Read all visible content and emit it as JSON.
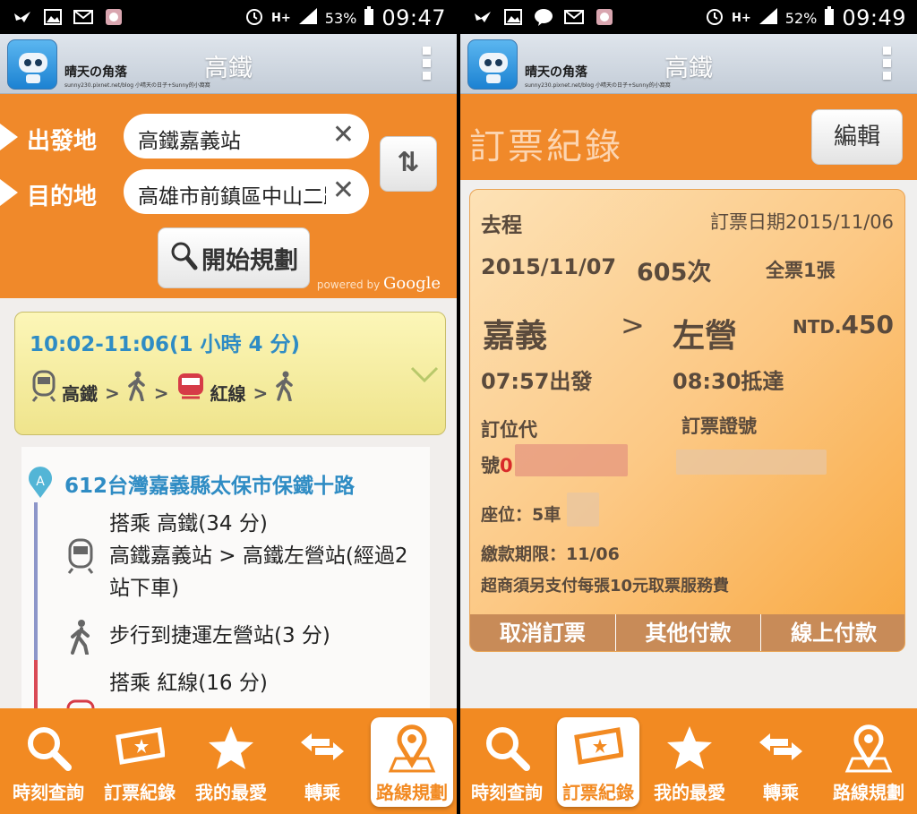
{
  "left": {
    "status": {
      "battery": "53%",
      "time": "09:47",
      "network": "H+"
    },
    "appbar": {
      "title": "高鐵",
      "brand": "晴天の角落",
      "brand_sub": "sunny230.pixnet.net/blog 小晴天の日子+Sunny的小窩窩"
    },
    "search": {
      "origin_label": "出發地",
      "origin_value": "高鐵嘉義站",
      "dest_label": "目的地",
      "dest_value": "高雄市前鎮區中山二路",
      "clear": "✕",
      "swap": "⇅",
      "plan_button": "開始規劃",
      "powered": "powered by",
      "google": "Google"
    },
    "route": {
      "time": "10:02-11:06(1 小時 4 分)",
      "seg1": "高鐵",
      "seg2": "紅線",
      "sep": ">"
    },
    "details": {
      "marker": "A",
      "address": "612台灣嘉義縣太保市保鐵十路",
      "step1_line1": "搭乘 高鐵(34 分)",
      "step1_line2": "高鐵嘉義站 > 高鐵左營站(經過2",
      "step1_line3": "站下車)",
      "step2": "步行到捷運左營站(3 分)",
      "step3": "搭乘 紅線(16 分)"
    }
  },
  "right": {
    "status": {
      "battery": "52%",
      "time": "09:49",
      "network": "H+"
    },
    "appbar": {
      "title": "高鐵",
      "brand": "晴天の角落",
      "brand_sub": "sunny230.pixnet.net/blog 小晴天の日子+Sunny的小窩窩"
    },
    "header": {
      "title": "訂票紀錄",
      "edit": "編輯"
    },
    "ticket": {
      "direction": "去程",
      "order_date": "訂票日期2015/11/06",
      "date": "2015/11/07",
      "train": "605次",
      "ticket_type": "全票1張",
      "from": "嘉義",
      "arrow": ">",
      "to": "左營",
      "price_prefix": "NTD.",
      "price": "450",
      "depart": "07:57出發",
      "arrive": "08:30抵達",
      "code_label_1": "訂位代",
      "code_label_2": "號",
      "code_prefix": "0",
      "ticket_no_label": "訂票證號",
      "seat": "座位：5車",
      "deadline": "繳款期限：11/06",
      "notice": "超商須另支付每張10元取票服務費",
      "actions": [
        "取消訂票",
        "其他付款",
        "線上付款"
      ]
    }
  },
  "nav": [
    "時刻查詢",
    "訂票紀錄",
    "我的最愛",
    "轉乘",
    "路線規劃"
  ],
  "colors": {
    "orange": "#f0892a",
    "blue": "#2f8cc4",
    "yellow": "#fcf6b8"
  }
}
